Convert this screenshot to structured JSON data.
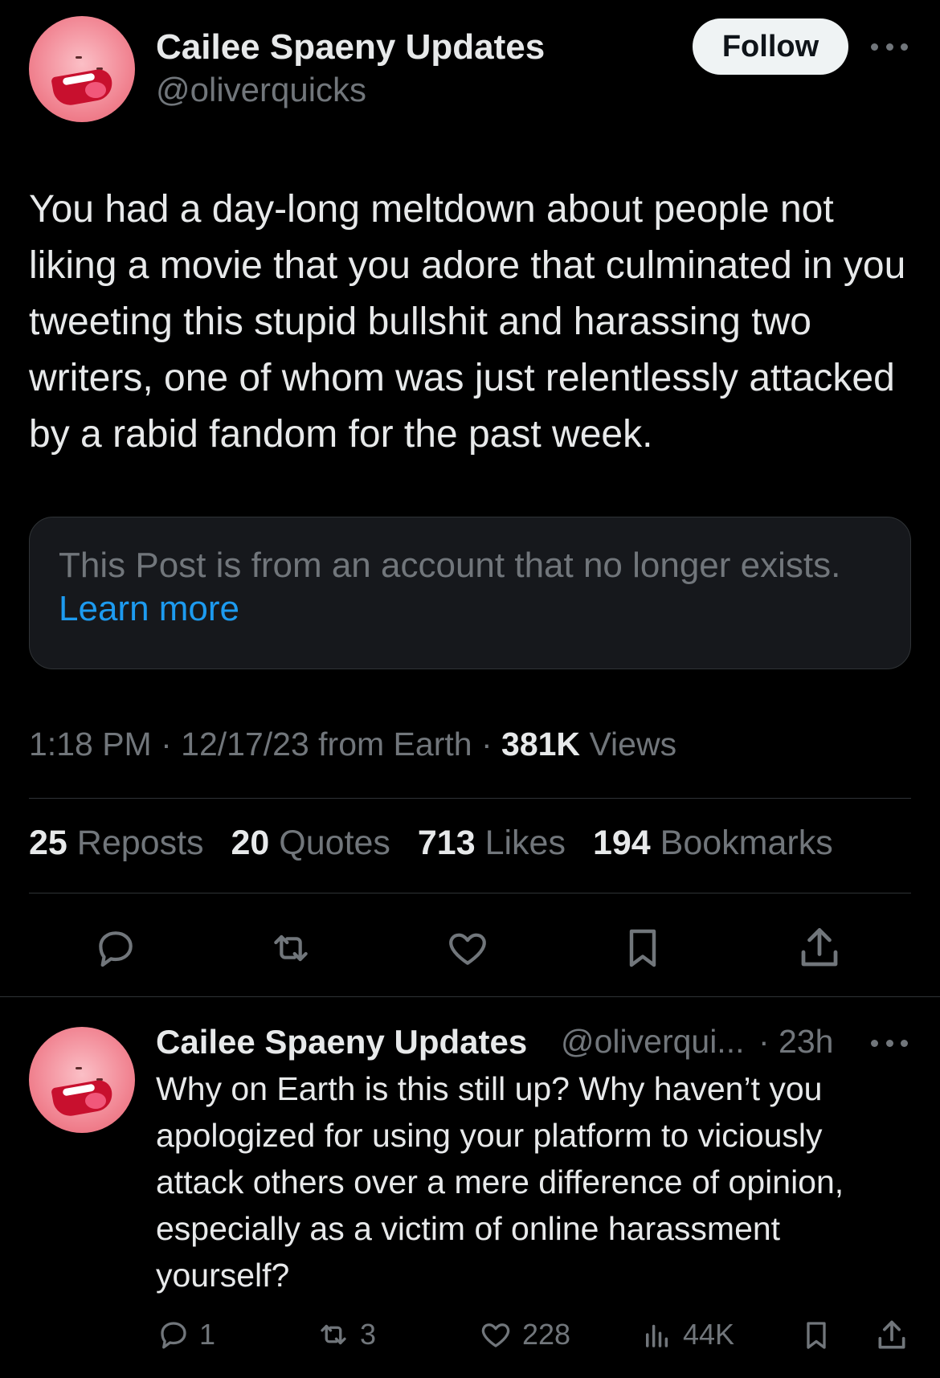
{
  "tweet": {
    "author_name": "Cailee Spaeny Updates",
    "author_handle": "@oliverquicks",
    "follow_label": "Follow",
    "text": "You had a day-long meltdown about people not liking a movie that you adore that culminated in you tweeting this stupid bullshit and harassing two writers, one of whom was just relentlessly attacked by a rabid fandom for the past week.",
    "notice_text": "This Post is from an account that no longer exists.",
    "notice_link": "Learn more",
    "time": "1:18 PM",
    "date_source": "12/17/23 from Earth",
    "sep": "·",
    "views_count": "381K",
    "views_label": "Views",
    "stats": [
      {
        "count": "25",
        "label": "Reposts"
      },
      {
        "count": "20",
        "label": "Quotes"
      },
      {
        "count": "713",
        "label": "Likes"
      },
      {
        "count": "194",
        "label": "Bookmarks"
      }
    ],
    "actions": [
      "reply-icon",
      "repost-icon",
      "like-icon",
      "bookmark-icon",
      "share-icon"
    ]
  },
  "reply": {
    "author_name": "Cailee Spaeny Updates",
    "author_handle": "@oliverqui...",
    "time": "· 23h",
    "text": "Why on Earth is this still up? Why haven’t you apologized for using your platform to viciously attack others over a mere difference of opinion, especially as a victim of online harassment yourself?",
    "replies": "1",
    "reposts": "3",
    "likes": "228",
    "views": "44K"
  },
  "colors": {
    "background": "#000000",
    "text": "#e7e9ea",
    "muted": "#71767b",
    "link": "#1d9bf0",
    "divider": "#2f3336"
  }
}
